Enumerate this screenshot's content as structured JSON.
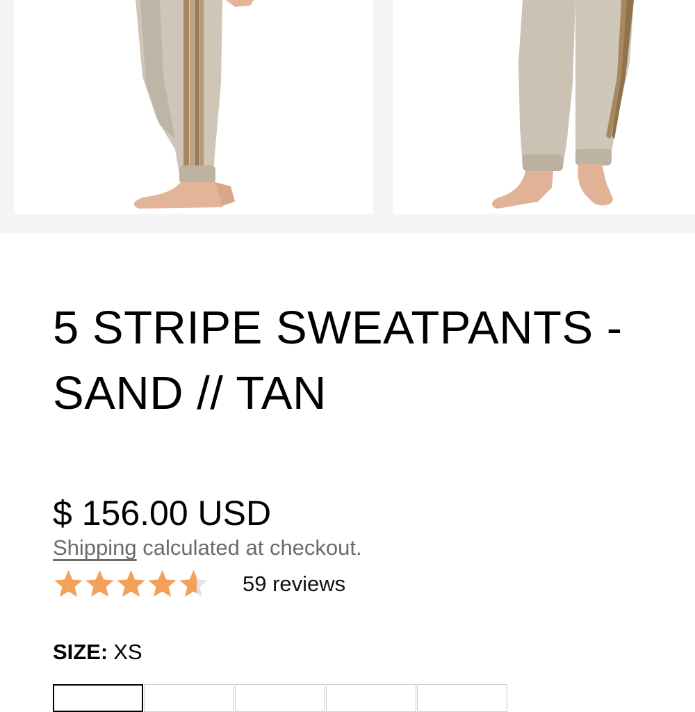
{
  "product": {
    "title": "5 STRIPE SWEATPANTS - SAND // TAN",
    "price": "$ 156.00 USD",
    "shipping_link": "Shipping",
    "shipping_rest": " calculated at checkout.",
    "rating": 4.6,
    "rating_max": 5,
    "reviews": "59 reviews",
    "size_label": "SIZE:",
    "size_value": "XS",
    "size_options_visible": 5,
    "selected_size_index": 0
  },
  "colors": {
    "star": "#f3a058",
    "star_empty": "#e3e3e3",
    "pant": "#c9bfb1",
    "stripe": "#a98a63",
    "skin": "#e8b79a"
  },
  "images": [
    {
      "alt": "sweatpants side view"
    },
    {
      "alt": "sweatpants front view"
    }
  ]
}
